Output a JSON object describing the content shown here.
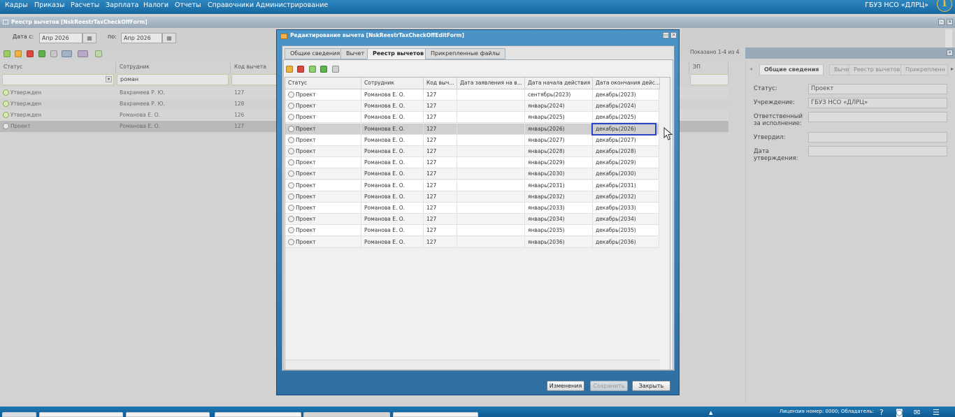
{
  "menu": [
    "Кадры",
    "Приказы",
    "Расчеты",
    "Зарплата",
    "Налоги",
    "Отчеты",
    "Справочники",
    "Администрирование"
  ],
  "org": "ГБУЗ НСО «ДЛРЦ»",
  "main_window": {
    "title": "Реестр вычетов [NskReestrTaxCheckOffForm]",
    "filter": {
      "date_from_label": "Дата с:",
      "date_from": "Апр 2026",
      "date_to_label": "по:",
      "date_to": "Апр 2026"
    },
    "showing": "Показано 1-4 из 4",
    "columns": [
      "Статус",
      "Сотрудник",
      "Код вычета",
      "ЭП"
    ],
    "filter_employee": "роман",
    "rows": [
      {
        "status": "Утвержден",
        "employee": "Вахрамеев Р. Ю.",
        "code": "127"
      },
      {
        "status": "Утвержден",
        "employee": "Вахрамеев Р. Ю.",
        "code": "128"
      },
      {
        "status": "Утвержден",
        "employee": "Романова Е. О.",
        "code": "126"
      },
      {
        "status": "Проект",
        "employee": "Романова Е. О.",
        "code": "127"
      }
    ]
  },
  "right_panel": {
    "tabs": [
      "Общие сведения",
      "Вычет",
      "Реестр вычетов",
      "Прикрепленн"
    ],
    "fields": [
      {
        "label": "Статус:",
        "value": "Проект"
      },
      {
        "label": "Учреждение:",
        "value": "ГБУЗ НСО «ДЛРЦ»"
      },
      {
        "label": "Ответственный за исполнение:",
        "value": ""
      },
      {
        "label": "Утвердил:",
        "value": ""
      },
      {
        "label": "Дата утверждения:",
        "value": ""
      }
    ]
  },
  "dialog": {
    "title": "Редактирование вычета [NskReestrTaxCheckOffEditForm]",
    "tabs": [
      "Общие сведения",
      "Вычет",
      "Реестр вычетов",
      "Прикрепленные файлы"
    ],
    "active_tab": "Реестр вычетов",
    "columns": [
      "Статус",
      "Сотрудник",
      "Код выч...",
      "Дата заявления на в...",
      "Дата начала действия",
      "Дата окончания дейс..."
    ],
    "rows": [
      {
        "status": "Проект",
        "employee": "Романова Е. О.",
        "code": "127",
        "app_date": "",
        "start": "сентябрь(2023)",
        "end": "декабрь(2023)"
      },
      {
        "status": "Проект",
        "employee": "Романова Е. О.",
        "code": "127",
        "app_date": "",
        "start": "январь(2024)",
        "end": "декабрь(2024)"
      },
      {
        "status": "Проект",
        "employee": "Романова Е. О.",
        "code": "127",
        "app_date": "",
        "start": "январь(2025)",
        "end": "декабрь(2025)"
      },
      {
        "status": "Проект",
        "employee": "Романова Е. О.",
        "code": "127",
        "app_date": "",
        "start": "январь(2026)",
        "end": "декабрь(2026)"
      },
      {
        "status": "Проект",
        "employee": "Романова Е. О.",
        "code": "127",
        "app_date": "",
        "start": "январь(2027)",
        "end": "декабрь(2027)"
      },
      {
        "status": "Проект",
        "employee": "Романова Е. О.",
        "code": "127",
        "app_date": "",
        "start": "январь(2028)",
        "end": "декабрь(2028)"
      },
      {
        "status": "Проект",
        "employee": "Романова Е. О.",
        "code": "127",
        "app_date": "",
        "start": "январь(2029)",
        "end": "декабрь(2029)"
      },
      {
        "status": "Проект",
        "employee": "Романова Е. О.",
        "code": "127",
        "app_date": "",
        "start": "январь(2030)",
        "end": "декабрь(2030)"
      },
      {
        "status": "Проект",
        "employee": "Романова Е. О.",
        "code": "127",
        "app_date": "",
        "start": "январь(2031)",
        "end": "декабрь(2031)"
      },
      {
        "status": "Проект",
        "employee": "Романова Е. О.",
        "code": "127",
        "app_date": "",
        "start": "январь(2032)",
        "end": "декабрь(2032)"
      },
      {
        "status": "Проект",
        "employee": "Романова Е. О.",
        "code": "127",
        "app_date": "",
        "start": "январь(2033)",
        "end": "декабрь(2033)"
      },
      {
        "status": "Проект",
        "employee": "Романова Е. О.",
        "code": "127",
        "app_date": "",
        "start": "январь(2034)",
        "end": "декабрь(2034)"
      },
      {
        "status": "Проект",
        "employee": "Романова Е. О.",
        "code": "127",
        "app_date": "",
        "start": "январь(2035)",
        "end": "декабрь(2035)"
      },
      {
        "status": "Проект",
        "employee": "Романова Е. О.",
        "code": "127",
        "app_date": "",
        "start": "январь(2036)",
        "end": "декабрь(2036)"
      }
    ],
    "selected_row": 3,
    "buttons": {
      "changes": "Изменения",
      "save": "Сохранить",
      "close": "Закрыть"
    }
  },
  "status_bar": {
    "license": "Лицензия номер: 0000; Обладатель:"
  },
  "colors": {
    "menubar": "#1f77b3",
    "accent": "#2a43c7",
    "approved": "#8ab04f"
  }
}
